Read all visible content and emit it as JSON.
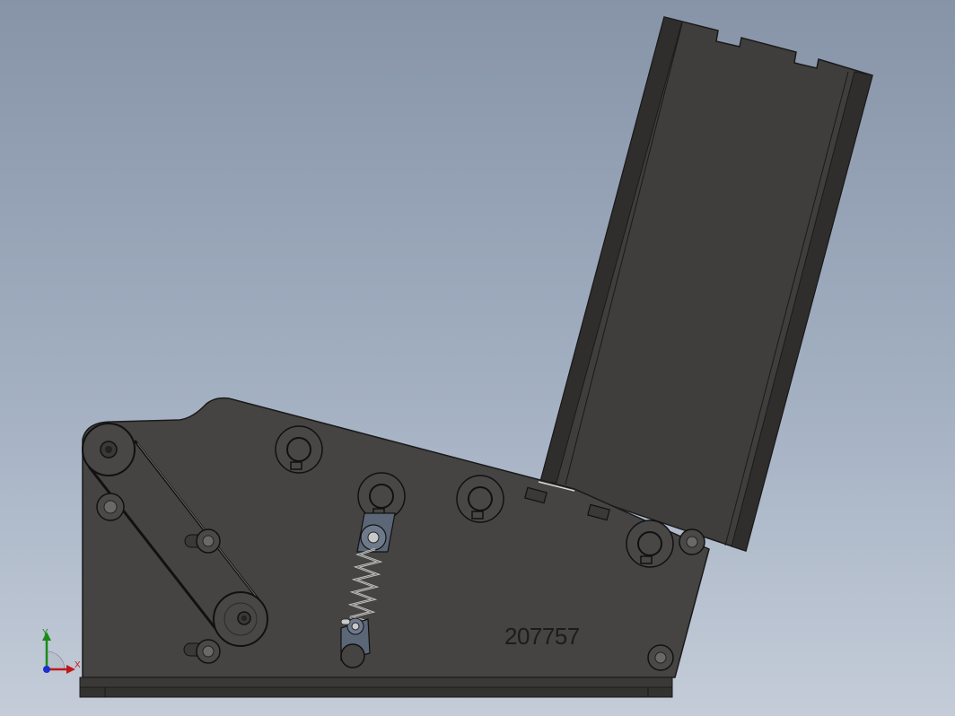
{
  "viewport": {
    "background_top": "#8794a8",
    "background_bottom": "#c4ccd8"
  },
  "model": {
    "part_number": "207757",
    "plate_color": "#454443",
    "chute_color": "#3f3e3d",
    "outline_color": "#1a1a1a"
  },
  "triad": {
    "y_label": "Y",
    "x_label": "X",
    "y_color": "#1a8a1a",
    "x_color": "#c01818",
    "z_color": "#1a2fd0"
  },
  "icons": [
    "pulley-icon",
    "belt-icon",
    "bolt-icon",
    "retaining-ring-icon",
    "spring-icon",
    "coordinate-triad-icon"
  ]
}
